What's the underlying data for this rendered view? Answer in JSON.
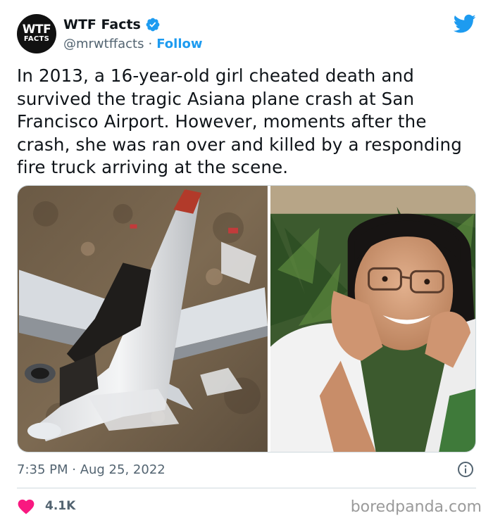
{
  "tweet": {
    "avatar": {
      "line1": "WTF",
      "line2": "FACTS",
      "icon": "wtf-facts-logo"
    },
    "display_name": "WTF Facts",
    "verified_icon": "verified-badge-icon",
    "handle": "@mrwtffacts",
    "separator": "·",
    "follow_label": "Follow",
    "platform_icon": "twitter-bird-icon",
    "text": "In 2013, a 16-year-old girl cheated death and survived the tragic Asiana plane crash at San Francisco Airport. However, moments after the crash, she was ran over and killed by a responding fire truck arriving at the scene.",
    "media": [
      {
        "description": "aerial-photo-of-crashed-burned-airliner"
      },
      {
        "description": "photo-of-smiling-girl-with-glasses"
      }
    ],
    "timestamp": "7:35 PM · Aug 25, 2022",
    "info_icon": "info-icon",
    "like_icon": "heart-icon",
    "like_count": "4.1K"
  },
  "watermark": "boredpanda.com",
  "colors": {
    "accent": "#1d9bf0",
    "text": "#0f1419",
    "secondary": "#536471",
    "heart": "#f91880",
    "divider": "#cfd9de"
  }
}
